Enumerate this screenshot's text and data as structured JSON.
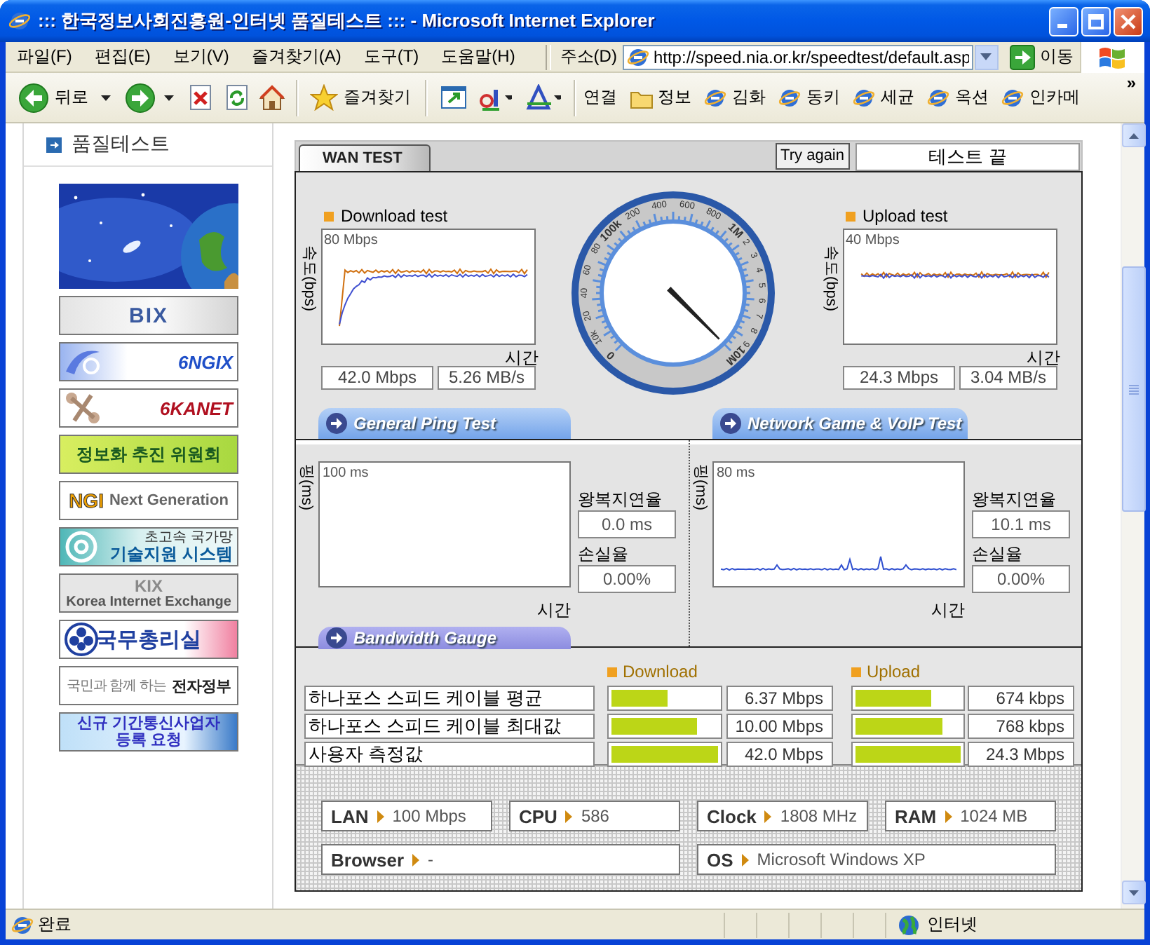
{
  "window": {
    "title": "::: 한국정보사회진흥원-인터넷 품질테스트 ::: - Microsoft Internet Explorer"
  },
  "menu": [
    "파일(F)",
    "편집(E)",
    "보기(V)",
    "즐겨찾기(A)",
    "도구(T)",
    "도움말(H)"
  ],
  "address": {
    "label": "주소(D)",
    "value": "http://speed.nia.or.kr/speedtest/default.asp",
    "go": "이동"
  },
  "toolbar": {
    "back": "뒤로",
    "favorites": "즐겨찾기",
    "links_label": "연결",
    "links": [
      {
        "label": "정보",
        "kind": "folder"
      },
      {
        "label": "김화",
        "kind": "page"
      },
      {
        "label": "동키",
        "kind": "page"
      },
      {
        "label": "세균",
        "kind": "page"
      },
      {
        "label": "옥션",
        "kind": "page"
      },
      {
        "label": "인카메",
        "kind": "page"
      }
    ],
    "more": "»"
  },
  "sidebar": {
    "heading": "품질테스트",
    "banners": [
      {
        "kind": "picture"
      },
      {
        "kind": "bix",
        "parts": [
          "BIX"
        ]
      },
      {
        "kind": "ngix",
        "parts": [
          "6NGIX"
        ]
      },
      {
        "kind": "kanet",
        "parts": [
          "6KANET"
        ]
      },
      {
        "kind": "committee",
        "parts": [
          "정보화 추진 위원회"
        ]
      },
      {
        "kind": "ngi",
        "parts": [
          "NGI",
          "Next Generation"
        ]
      },
      {
        "kind": "tech",
        "parts": [
          "초고속 국가망",
          "기술지원 시스템"
        ]
      },
      {
        "kind": "kix",
        "parts": [
          "KIX",
          "Korea Internet Exchange"
        ]
      },
      {
        "kind": "pm",
        "parts": [
          "국무총리실"
        ]
      },
      {
        "kind": "egov",
        "parts": [
          "국민과 함께 하는",
          "전자정부"
        ]
      },
      {
        "kind": "register",
        "parts": [
          "신규 기간통신사업자",
          "등록 요청"
        ]
      }
    ]
  },
  "test": {
    "tab": "WAN TEST",
    "try_again": "Try again",
    "status": "테스트 끝",
    "download": {
      "title": "Download test",
      "y_label": "속도(bps)",
      "max": "80 Mbps",
      "x_label": "시간",
      "mbps": "42.0 Mbps",
      "mbs": "5.26 MB/s"
    },
    "upload": {
      "title": "Upload test",
      "y_label": "속도(bps)",
      "max": "40 Mbps",
      "x_label": "시간",
      "mbps": "24.3 Mbps",
      "mbs": "3.04 MB/s"
    },
    "gauge": {
      "decades": [
        [
          "0",
          "10k",
          "20",
          "40",
          "60",
          "80"
        ],
        [
          "100k",
          "200",
          "400",
          "600",
          "800"
        ],
        [
          "1M",
          "2",
          "3",
          "4",
          "5",
          "6",
          "7",
          "8",
          "9"
        ]
      ],
      "end": "10M"
    },
    "ping_tabs": [
      "General Ping Test",
      "Network Game & VoIP Test"
    ],
    "ping": [
      {
        "y_label": "핑(ms)",
        "max": "100 ms",
        "x_label": "시간",
        "rtt_label": "왕복지연율",
        "rtt": "0.0 ms",
        "loss_label": "손실율",
        "loss": "0.00%",
        "trace": false
      },
      {
        "y_label": "핑(ms)",
        "max": "80 ms",
        "x_label": "시간",
        "rtt_label": "왕복지연율",
        "rtt": "10.1 ms",
        "loss_label": "손실율",
        "loss": "0.00%",
        "trace": true
      }
    ],
    "bandwidth": {
      "tab": "Bandwidth Gauge",
      "download_label": "Download",
      "upload_label": "Upload",
      "rows": [
        {
          "label": "하나포스 스피드 케이블 평균",
          "download": {
            "level": 0.52,
            "value": "6.37 Mbps"
          },
          "upload": {
            "level": 0.72,
            "value": "674 kbps"
          }
        },
        {
          "label": "하나포스 스피드 케이블 최대값",
          "download": {
            "level": 0.8,
            "value": "10.00 Mbps"
          },
          "upload": {
            "level": 0.82,
            "value": "768 kbps"
          }
        },
        {
          "label": "사용자 측정값",
          "download": {
            "level": 1,
            "value": "42.0 Mbps"
          },
          "upload": {
            "level": 1,
            "value": "24.3 Mbps"
          }
        }
      ]
    },
    "system": [
      {
        "label": "LAN",
        "value": "100 Mbps"
      },
      {
        "label": "CPU",
        "value": "586"
      },
      {
        "label": "Clock",
        "value": "1808 MHz"
      },
      {
        "label": "RAM",
        "value": "1024 MB"
      },
      {
        "label": "Browser",
        "value": "-"
      },
      {
        "label": "OS",
        "value": "Microsoft Windows XP"
      }
    ]
  },
  "status_bar": {
    "text": "완료",
    "zone": "인터넷"
  }
}
